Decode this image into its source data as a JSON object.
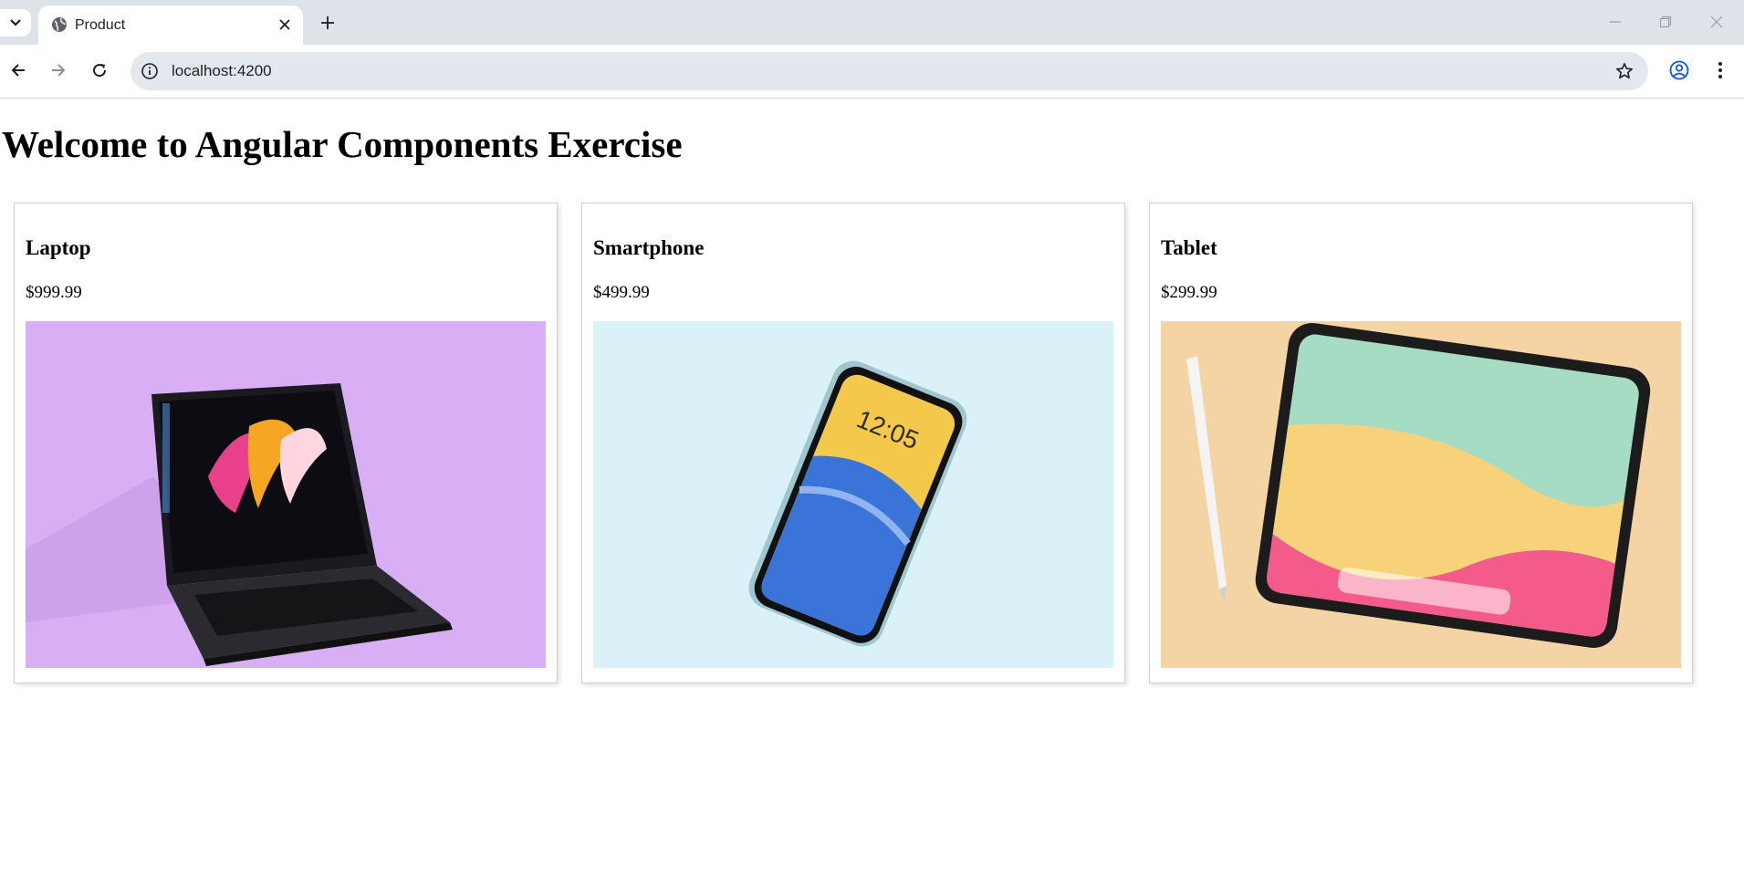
{
  "browser": {
    "tab_title": "Product",
    "url": "localhost:4200"
  },
  "page": {
    "heading": "Welcome to Angular Components Exercise"
  },
  "products": [
    {
      "name": "Laptop",
      "price": "$999.99",
      "image": "laptop-photo"
    },
    {
      "name": "Smartphone",
      "price": "$499.99",
      "image": "smartphone-photo",
      "screen_time": "12:05"
    },
    {
      "name": "Tablet",
      "price": "$299.99",
      "image": "tablet-photo"
    }
  ],
  "icons": {
    "tab_search": "chevron-down-icon",
    "tab_favicon": "globe-icon",
    "tab_close": "close-icon",
    "new_tab": "plus-icon",
    "back": "arrow-left-icon",
    "forward": "arrow-right-icon",
    "reload": "reload-icon",
    "site_info": "info-icon",
    "bookmark": "star-icon",
    "profile": "profile-icon",
    "menu": "kebab-menu-icon"
  }
}
